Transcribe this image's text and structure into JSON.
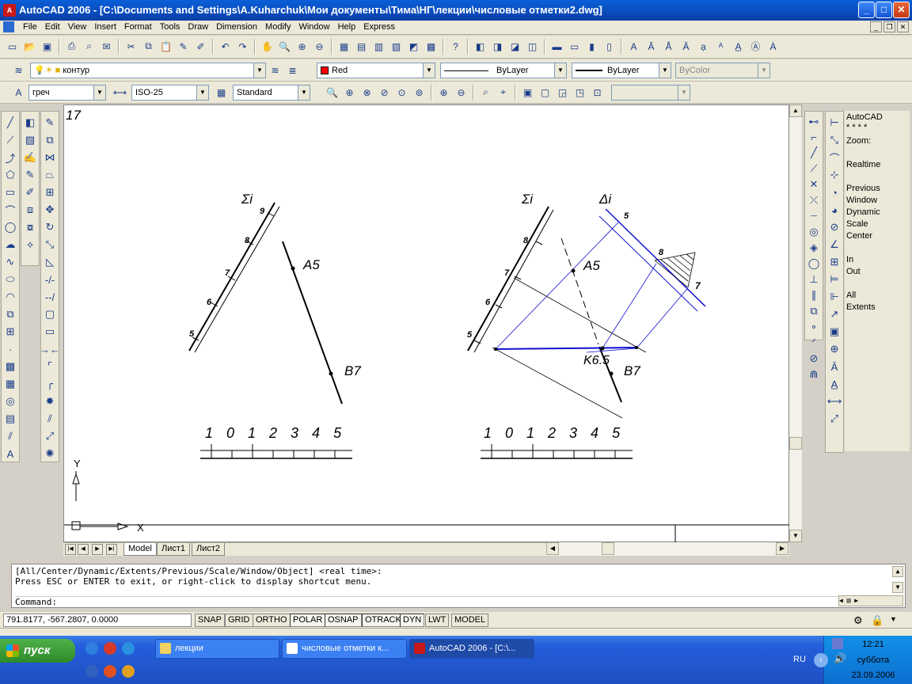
{
  "window": {
    "title": "AutoCAD 2006 - [C:\\Documents and Settings\\A.Kuharchuk\\Мои документы\\Тима\\НГ\\лекции\\числовые отметки2.dwg]"
  },
  "menu": [
    "File",
    "Edit",
    "View",
    "Insert",
    "Format",
    "Tools",
    "Draw",
    "Dimension",
    "Modify",
    "Window",
    "Help",
    "Express"
  ],
  "layers": {
    "layer_name": "контур",
    "color": "Red",
    "linetype": "ByLayer",
    "lineweight": "ByLayer",
    "plotstyle": "ByColor"
  },
  "styles": {
    "text_style": "греч",
    "dim_style": "ISO-25",
    "table_style": "Standard"
  },
  "drawing": {
    "sheet_number": "17",
    "left": {
      "sigma_label": "Σi",
      "ticks": [
        "9",
        "8",
        "7",
        "6",
        "5"
      ],
      "point_a": "A5",
      "point_b": "B7"
    },
    "right": {
      "sigma_label": "Σi",
      "delta_label": "Δi",
      "delta_5": "5",
      "ticks": [
        "8",
        "7",
        "6",
        "5"
      ],
      "point_a": "A5",
      "point_b": "B7",
      "point_k": "K6.5",
      "label_8": "8",
      "label_7": "7"
    },
    "scale_text": "1 0 1 2 3 4 5",
    "ucs_y": "Y",
    "ucs_x": "X"
  },
  "tabs": [
    "Model",
    "Лист1",
    "Лист2"
  ],
  "zoom_panel": [
    "AutoCAD",
    "* * * *",
    "Zoom:",
    "Realtime",
    "Previous",
    "Window",
    "Dynamic",
    "Scale",
    "Center",
    "In",
    "Out",
    "All",
    "Extents"
  ],
  "command": {
    "line1": "[All/Center/Dynamic/Extents/Previous/Scale/Window/Object] <real time>:",
    "line2": "Press ESC or ENTER to exit, or right-click to display shortcut menu.",
    "prompt": "Command:"
  },
  "status": {
    "coords": "791.8177, -567.2807, 0.0000",
    "buttons": [
      "SNAP",
      "GRID",
      "ORTHO",
      "POLAR",
      "OSNAP",
      "OTRACK",
      "DYN",
      "LWT",
      "MODEL"
    ]
  },
  "taskbar": {
    "start": "пуск",
    "tasks": [
      "лекции",
      "числовые отметки к...",
      "AutoCAD 2006 - [C:\\..."
    ],
    "lang": "RU",
    "time": "12:21",
    "day": "суббота",
    "date": "23.09.2006"
  }
}
